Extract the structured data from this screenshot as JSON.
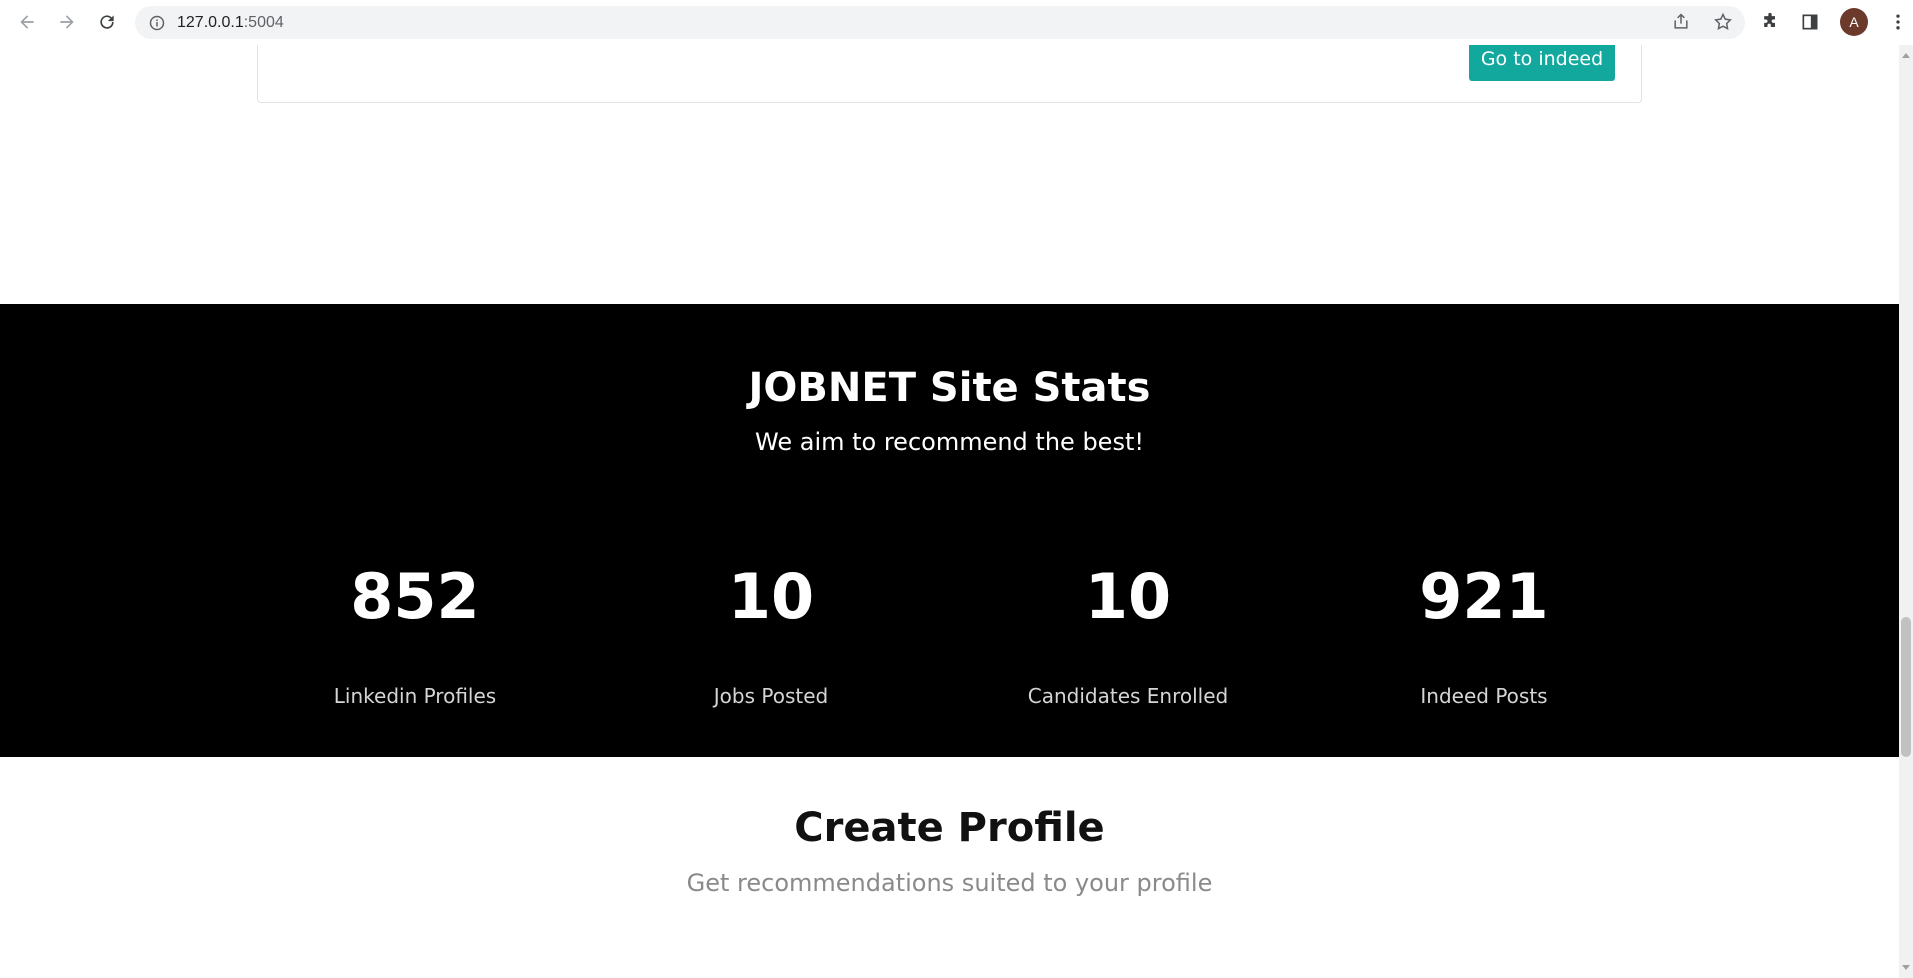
{
  "browser": {
    "url_host": "127.0.0.1",
    "url_port": ":5004",
    "avatar_letter": "A"
  },
  "indeed_card": {
    "button_label": "Go to indeed"
  },
  "stats": {
    "title": "JOBNET Site Stats",
    "subtitle": "We aim to recommend the best!",
    "items": [
      {
        "value": "852",
        "label": "Linkedin Profiles"
      },
      {
        "value": "10",
        "label": "Jobs Posted"
      },
      {
        "value": "10",
        "label": "Candidates Enrolled"
      },
      {
        "value": "921",
        "label": "Indeed Posts"
      }
    ]
  },
  "create_profile": {
    "title": "Create Profile",
    "subtitle": "Get recommendations suited to your profile"
  },
  "colors": {
    "accent": "#13a89e",
    "stats_bg": "#000000"
  }
}
